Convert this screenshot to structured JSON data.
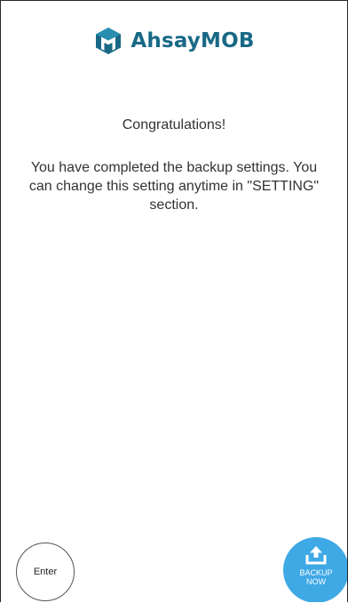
{
  "brand": {
    "name": "AhsayMOB",
    "logo_icon": "ahsay-cube-logo-icon",
    "color": "#196986"
  },
  "content": {
    "title": "Congratulations!",
    "message": "You have completed the backup settings. You can change this setting anytime in \"SETTING\" section."
  },
  "actions": {
    "enter_label": "Enter",
    "backup_label_line1": "BACKUP",
    "backup_label_line2": "NOW",
    "backup_icon": "upload-icon",
    "backup_color": "#3fa9e6"
  }
}
